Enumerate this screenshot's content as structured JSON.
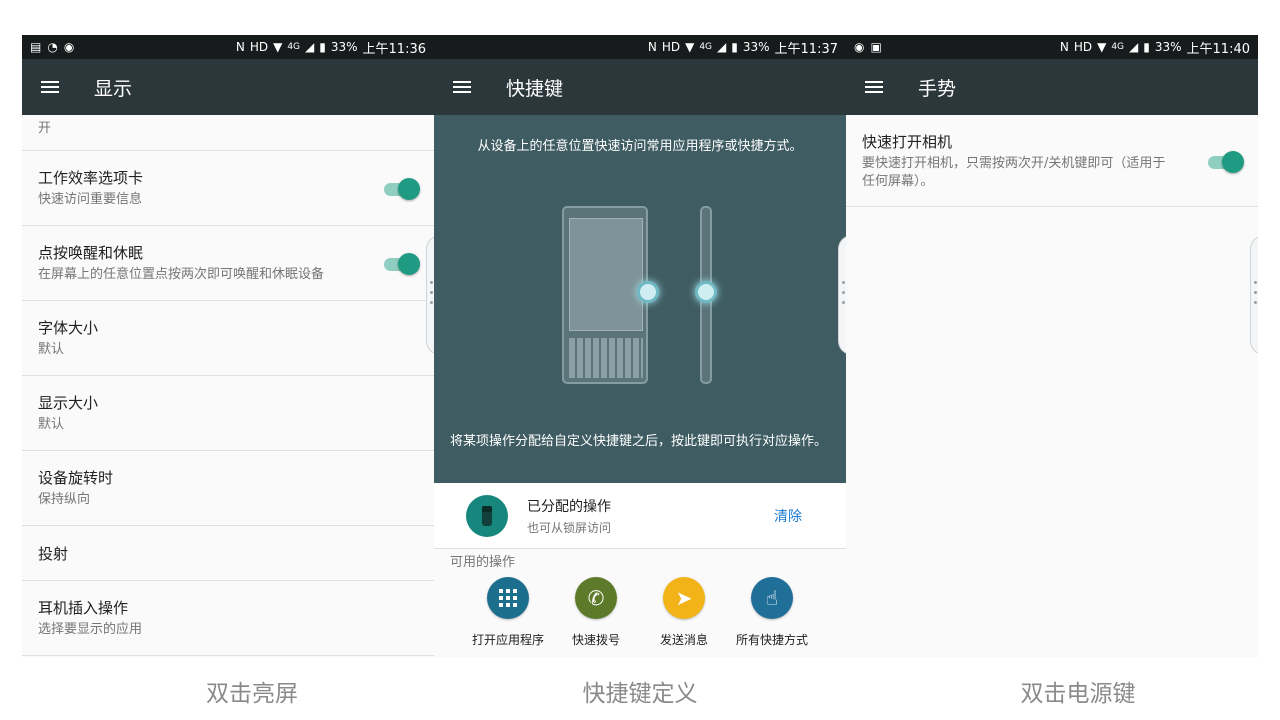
{
  "colors": {
    "appbar": "#2c373b",
    "statusbar": "#171b1c",
    "toggle_on": "#1e9b82",
    "hero": "#3e5c62",
    "link": "#1a7bd4"
  },
  "screens": [
    {
      "status": {
        "left_icons": [
          "message-icon",
          "sync-icon",
          "app-icon"
        ],
        "nfc": "N",
        "hd": "HD",
        "net": "4G",
        "battery": "33%",
        "time": "上午11:36"
      },
      "title": "显示",
      "partial_text": "开",
      "rows": [
        {
          "title": "工作效率选项卡",
          "sub": "快速访问重要信息",
          "toggle": "on"
        },
        {
          "title": "点按唤醒和休眠",
          "sub": "在屏幕上的任意位置点按两次即可唤醒和休眠设备",
          "toggle": "on"
        },
        {
          "title": "字体大小",
          "sub": "默认"
        },
        {
          "title": "显示大小",
          "sub": "默认"
        },
        {
          "title": "设备旋转时",
          "sub": "保持纵向"
        },
        {
          "title": "投射",
          "sub": ""
        },
        {
          "title": "耳机插入操作",
          "sub": "选择要显示的应用"
        }
      ],
      "caption": "双击亮屏"
    },
    {
      "status": {
        "nfc": "N",
        "hd": "HD",
        "net": "4G",
        "battery": "33%",
        "time": "上午11:37"
      },
      "title": "快捷键",
      "hero_top": "从设备上的任意位置快速访问常用应用程序或快捷方式。",
      "hero_bottom": "将某项操作分配给自定义快捷键之后，按此键即可执行对应操作。",
      "assigned": {
        "title": "已分配的操作",
        "sub": "也可从锁屏访问",
        "clear": "清除"
      },
      "available_label": "可用的操作",
      "actions": [
        {
          "label": "打开应用程序",
          "icon": "apps-grid-icon",
          "color": "#1b6e8c"
        },
        {
          "label": "快速拨号",
          "icon": "phone-icon",
          "color": "#5d7a2a"
        },
        {
          "label": "发送消息",
          "icon": "send-icon",
          "color": "#f2b318"
        },
        {
          "label": "所有快捷方式",
          "icon": "touch-icon",
          "color": "#1f6f98"
        }
      ],
      "caption": "快捷键定义"
    },
    {
      "status": {
        "left_icons": [
          "app-icon",
          "image-icon"
        ],
        "nfc": "N",
        "hd": "HD",
        "net": "4G",
        "battery": "33%",
        "time": "上午11:40"
      },
      "title": "手势",
      "rows": [
        {
          "title": "快速打开相机",
          "sub": "要快速打开相机，只需按两次开/关机键即可（适用于任何屏幕）。",
          "toggle": "on"
        }
      ],
      "caption": "双击电源键"
    }
  ]
}
